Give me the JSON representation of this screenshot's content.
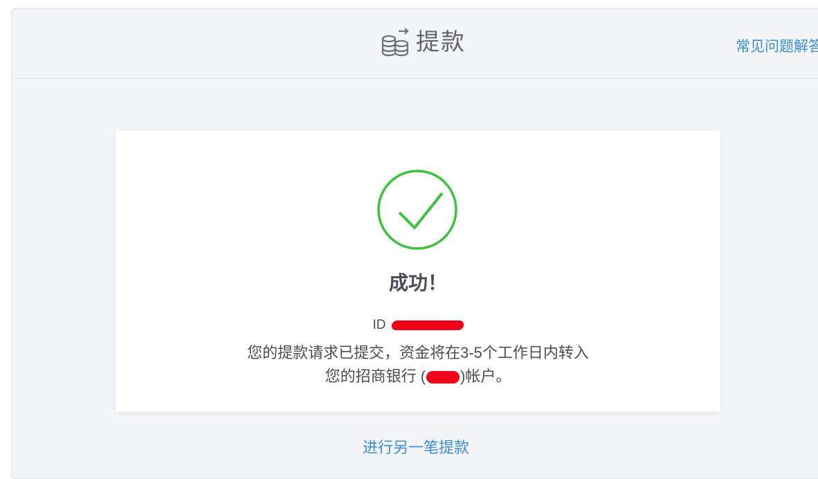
{
  "header": {
    "title": "提款",
    "title_icon": "coins-transfer-icon",
    "faq_link": "常见问题解答"
  },
  "result": {
    "status_icon": "check-circle-icon",
    "title": "成功！",
    "id_label": "ID",
    "message_line1": "您的提款请求已提交，资金将在3-5个工作日内转入",
    "message_line2_prefix": "您的招商银行 (",
    "message_line2_suffix": ")帐户。"
  },
  "actions": {
    "new_withdrawal": "进行另一笔提款"
  },
  "colors": {
    "success_green": "#3cc23c",
    "link_blue": "#3a8dd6",
    "redaction_red": "#f00018",
    "page_bg": "#f4f5f9"
  }
}
